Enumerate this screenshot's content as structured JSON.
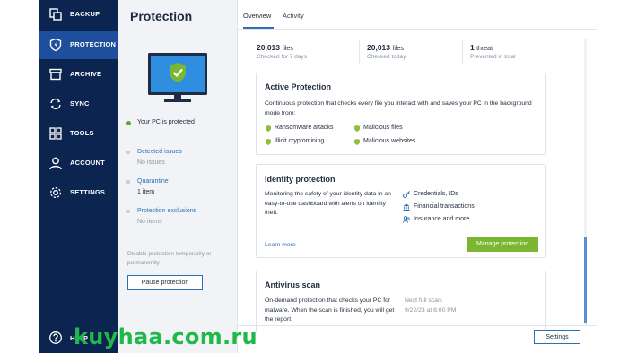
{
  "sidebar": {
    "items": [
      {
        "label": "BACKUP",
        "icon": "copy-icon"
      },
      {
        "label": "PROTECTION",
        "icon": "shield-icon"
      },
      {
        "label": "ARCHIVE",
        "icon": "archive-icon"
      },
      {
        "label": "SYNC",
        "icon": "sync-icon"
      },
      {
        "label": "TOOLS",
        "icon": "grid-icon"
      },
      {
        "label": "ACCOUNT",
        "icon": "user-icon"
      },
      {
        "label": "SETTINGS",
        "icon": "gear-icon"
      }
    ],
    "help_label": "HELP"
  },
  "left_panel": {
    "title": "Protection",
    "status": "Your PC is protected",
    "detected": {
      "label": "Detected issues",
      "value": "No issues"
    },
    "quarantine": {
      "label": "Quarantine",
      "value": "1 item"
    },
    "exclusions": {
      "label": "Protection exclusions",
      "value": "No items"
    },
    "disable_text": "Disable protection temporarily or permanently",
    "pause_button": "Pause protection"
  },
  "tabs": [
    "Overview",
    "Activity"
  ],
  "stats": [
    {
      "value": "20,013",
      "unit": "files",
      "sub": "Checked for 7 days"
    },
    {
      "value": "20,013",
      "unit": "files",
      "sub": "Checked today"
    },
    {
      "value": "1",
      "unit": "threat",
      "sub": "Prevented in total"
    }
  ],
  "active_protection": {
    "title": "Active Protection",
    "description": "Continuous protection that checks every file you interact with and saves your PC in the background mode from:",
    "features": [
      "Ransomware attacks",
      "Malicious files",
      "Illicit cryptomining",
      "Malicious websites"
    ]
  },
  "identity_protection": {
    "title": "Identity protection",
    "description": "Monitoring the safety of your identity data in an easy-to-use dashboard with alerts on identity theft.",
    "features": [
      "Credentials, IDs",
      "Financial transactions",
      "Insurance and more..."
    ],
    "learn_more": "Learn more",
    "manage_button": "Manage protection"
  },
  "antivirus_scan": {
    "title": "Antivirus scan",
    "description": "On-demand protection that checks your PC for malware. When the scan is finished, you will get the report.",
    "next_scan_label": "Next full scan:",
    "next_scan_value": "9/22/23 at 6:00 PM"
  },
  "settings_button": "Settings",
  "watermark": "kuyhaa.com.ru",
  "colors": {
    "sidebar": "#0c2450",
    "active": "#1d4f9c",
    "accent": "#2d6fb5",
    "green": "#7ab632"
  }
}
